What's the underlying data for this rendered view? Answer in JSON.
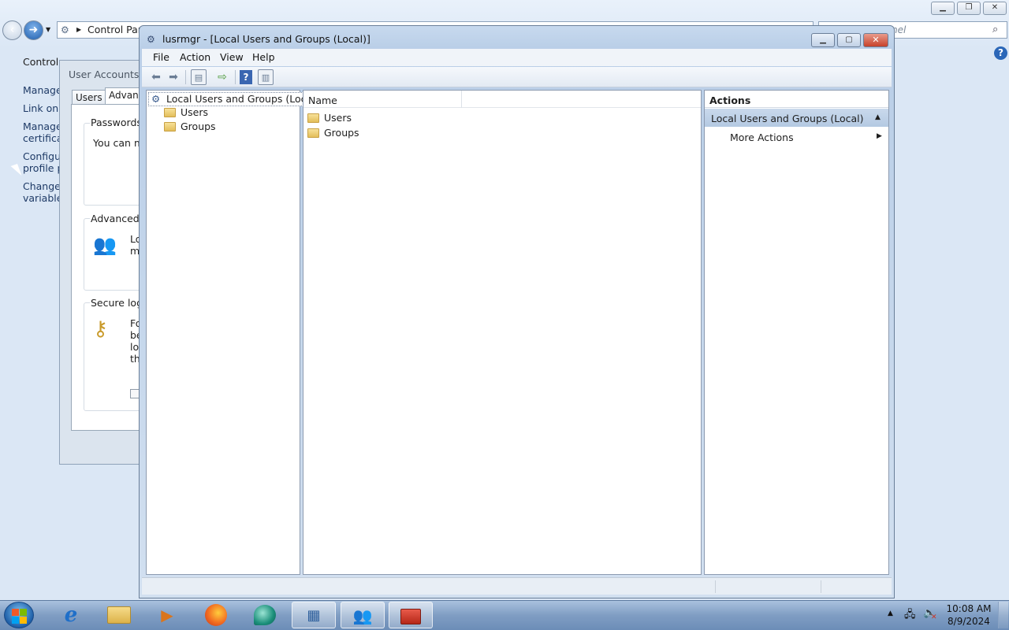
{
  "control_panel": {
    "address": "Control Panel",
    "search_placeholder": "nel",
    "side_links": [
      "Control P",
      "Manage",
      "Link onli",
      "Manage",
      "certificat",
      "Configu",
      "profile pr",
      "Change",
      "variables"
    ],
    "caption_buttons": [
      "minimize",
      "restore",
      "close"
    ]
  },
  "user_accounts": {
    "title": "User Accounts",
    "tabs": [
      "Users",
      "Advanc"
    ],
    "passwords_label": "Passwords",
    "passwords_text": "You can m",
    "advanced_label": "Advanced u",
    "advanced_text": [
      "Lo",
      "m"
    ],
    "secure_label": "Secure logo",
    "secure_text": [
      "Fo",
      "be",
      "lo",
      "th"
    ]
  },
  "mmc": {
    "title": "lusrmgr - [Local Users and Groups (Local)]",
    "menu": [
      "File",
      "Action",
      "View",
      "Help"
    ],
    "tree": {
      "root": "Local Users and Groups (Local)",
      "children": [
        "Users",
        "Groups"
      ]
    },
    "list": {
      "column_name": "Name",
      "rows": [
        "Users",
        "Groups"
      ]
    },
    "actions": {
      "header": "Actions",
      "section": "Local Users and Groups (Local)",
      "items": [
        "More Actions"
      ]
    }
  },
  "taskbar": {
    "apps": [
      "internet-explorer",
      "file-explorer",
      "media-player",
      "firefox",
      "app-5",
      "control-panel",
      "user-accounts",
      "computer-management"
    ],
    "active": [
      "control-panel",
      "user-accounts",
      "computer-management"
    ],
    "time": "10:08 AM",
    "date": "8/9/2024"
  }
}
